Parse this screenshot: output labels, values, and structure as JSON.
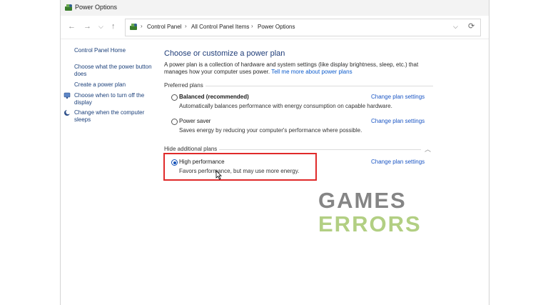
{
  "window": {
    "title": "Power Options"
  },
  "address": {
    "breadcrumbs": [
      "Control Panel",
      "All Control Panel Items",
      "Power Options"
    ]
  },
  "sidebar": {
    "home": "Control Panel Home",
    "items": [
      {
        "line1": "Choose what the power button",
        "line2": "does"
      },
      {
        "line1": "Create a power plan"
      },
      {
        "line1": "Choose when to turn off the",
        "line2": "display",
        "icon": "monitor-icon"
      },
      {
        "line1": "Change when the computer",
        "line2": "sleeps",
        "icon": "moon-icon"
      }
    ]
  },
  "main": {
    "heading": "Choose or customize a power plan",
    "intro_line1": "A power plan is a collection of hardware and system settings (like display brightness, sleep, etc.) that manages",
    "intro_line2": "how your computer uses power.",
    "intro_link": "Tell me more about power plans",
    "preferred_label": "Preferred plans",
    "additional_label": "Hide additional plans",
    "change_link": "Change plan settings",
    "plans": [
      {
        "name": "Balanced (recommended)",
        "desc": "Automatically balances performance with energy consumption on capable hardware.",
        "selected": false
      },
      {
        "name": "Power saver",
        "desc": "Saves energy by reducing your computer's performance where possible.",
        "selected": false
      },
      {
        "name": "High performance",
        "desc": "Favors performance, but may use more energy.",
        "selected": true
      }
    ]
  },
  "watermark": {
    "line1": "GAMES",
    "line2": "ERRORS"
  },
  "colors": {
    "accent": "#1452b8",
    "highlight": "#e02a2a",
    "link": "#1a55c4"
  }
}
